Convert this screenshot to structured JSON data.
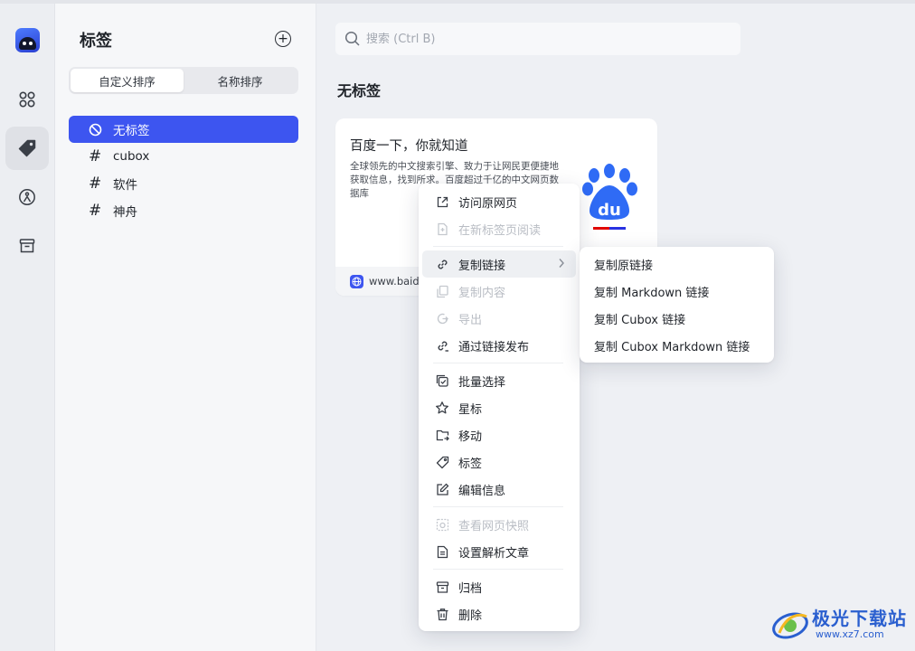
{
  "sidebar_rail": {
    "items": [
      {
        "icon": "apps-icon"
      },
      {
        "icon": "tag-icon",
        "active": true
      },
      {
        "icon": "reading-icon"
      },
      {
        "icon": "archive-icon"
      }
    ]
  },
  "tags_panel": {
    "title": "标签",
    "sort_tabs": [
      "自定义排序",
      "名称排序"
    ],
    "active_sort": 0,
    "items": [
      {
        "label": "无标签",
        "icon": "no-tag-icon",
        "selected": true
      },
      {
        "label": "cubox",
        "icon": "hash-icon"
      },
      {
        "label": "软件",
        "icon": "hash-icon"
      },
      {
        "label": "神舟",
        "icon": "hash-icon"
      }
    ]
  },
  "search": {
    "placeholder": "搜索 (Ctrl B)"
  },
  "main": {
    "section_title": "无标签",
    "card": {
      "title": "百度一下，你就知道",
      "description": "全球领先的中文搜索引擎、致力于让网民更便捷地获取信息，找到所求。百度超过千亿的中文网页数据库",
      "domain": "www.baid"
    }
  },
  "context_menu": {
    "items": [
      {
        "label": "访问原网页",
        "icon": "external-link-icon",
        "disabled": false
      },
      {
        "label": "在新标签页阅读",
        "icon": "new-tab-icon",
        "disabled": true
      },
      {
        "label": "复制链接",
        "icon": "link-icon",
        "disabled": false,
        "submenu": true
      },
      {
        "label": "复制内容",
        "icon": "copy-icon",
        "disabled": true
      },
      {
        "label": "导出",
        "icon": "export-icon",
        "disabled": true
      },
      {
        "label": "通过链接发布",
        "icon": "publish-link-icon",
        "disabled": false
      },
      {
        "label": "批量选择",
        "icon": "batch-select-icon",
        "disabled": false
      },
      {
        "label": "星标",
        "icon": "star-icon",
        "disabled": false
      },
      {
        "label": "移动",
        "icon": "move-icon",
        "disabled": false
      },
      {
        "label": "标签",
        "icon": "tag-icon",
        "disabled": false
      },
      {
        "label": "编辑信息",
        "icon": "edit-icon",
        "disabled": false
      },
      {
        "label": "查看网页快照",
        "icon": "snapshot-icon",
        "disabled": true
      },
      {
        "label": "设置解析文章",
        "icon": "article-icon",
        "disabled": false
      },
      {
        "label": "归档",
        "icon": "archive-icon",
        "disabled": false
      },
      {
        "label": "删除",
        "icon": "trash-icon",
        "disabled": false
      }
    ]
  },
  "submenu": {
    "items": [
      "复制原链接",
      "复制 Markdown 链接",
      "复制 Cubox 链接",
      "复制 Cubox Markdown 链接"
    ]
  },
  "watermark": {
    "name": "极光下载站",
    "url": "www.xz7.com"
  },
  "colors": {
    "accent": "#3d55f0",
    "baidu_blue": "#2932e1",
    "baidu_red": "#e10602"
  }
}
